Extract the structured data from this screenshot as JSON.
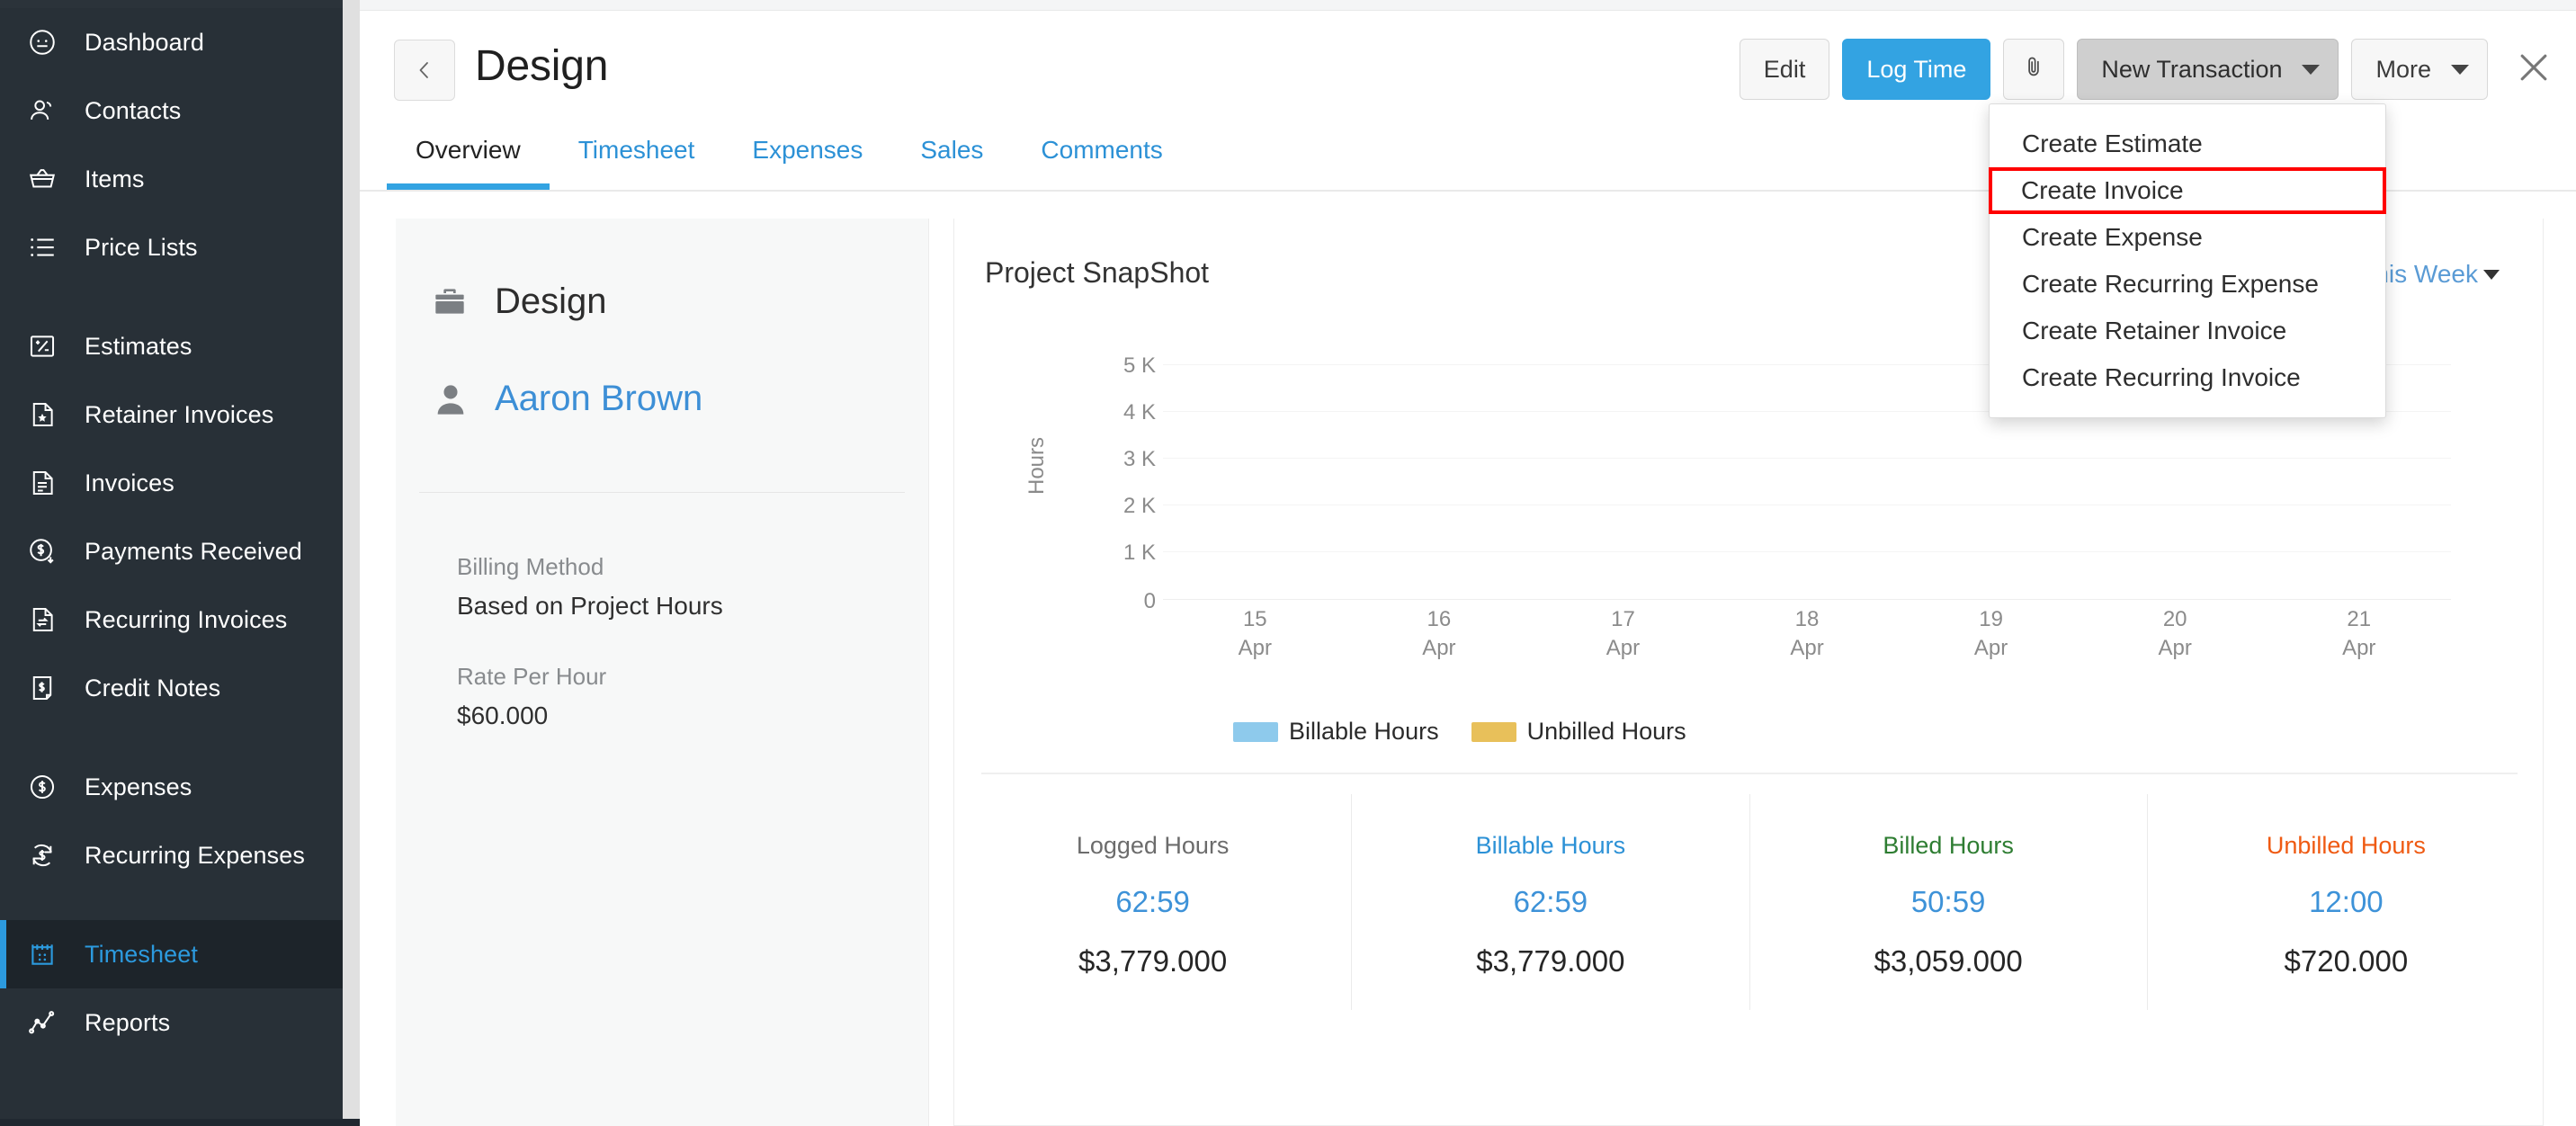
{
  "sidebar": {
    "items": [
      {
        "label": "Dashboard",
        "icon": "speedometer-icon",
        "active": false
      },
      {
        "label": "Contacts",
        "icon": "contacts-icon",
        "active": false
      },
      {
        "label": "Items",
        "icon": "basket-icon",
        "active": false
      },
      {
        "label": "Price Lists",
        "icon": "list-icon",
        "active": false
      },
      {
        "label": "Estimates",
        "icon": "estimate-icon",
        "active": false
      },
      {
        "label": "Retainer Invoices",
        "icon": "retainer-invoice-icon",
        "active": false
      },
      {
        "label": "Invoices",
        "icon": "invoice-icon",
        "active": false
      },
      {
        "label": "Payments Received",
        "icon": "payment-received-icon",
        "active": false
      },
      {
        "label": "Recurring Invoices",
        "icon": "recurring-invoice-icon",
        "active": false
      },
      {
        "label": "Credit Notes",
        "icon": "credit-note-icon",
        "active": false
      },
      {
        "label": "Expenses",
        "icon": "expense-icon",
        "active": false
      },
      {
        "label": "Recurring Expenses",
        "icon": "recurring-expense-icon",
        "active": false
      },
      {
        "label": "Timesheet",
        "icon": "timesheet-icon",
        "active": true
      },
      {
        "label": "Reports",
        "icon": "reports-icon",
        "active": false
      }
    ]
  },
  "header": {
    "back_icon": "chevron-left-icon",
    "title": "Design",
    "edit_label": "Edit",
    "log_time_label": "Log Time",
    "attachment_icon": "paperclip-icon",
    "new_transaction_label": "New Transaction",
    "more_label": "More",
    "close_icon": "close-icon"
  },
  "tabs": [
    {
      "label": "Overview",
      "selected": true
    },
    {
      "label": "Timesheet",
      "selected": false
    },
    {
      "label": "Expenses",
      "selected": false
    },
    {
      "label": "Sales",
      "selected": false
    },
    {
      "label": "Comments",
      "selected": false
    }
  ],
  "transaction_menu": {
    "items": [
      {
        "label": "Create Estimate",
        "highlighted": false
      },
      {
        "label": "Create Invoice",
        "highlighted": true
      },
      {
        "label": "Create Expense",
        "highlighted": false
      },
      {
        "label": "Create Recurring Expense",
        "highlighted": false
      },
      {
        "label": "Create Retainer Invoice",
        "highlighted": false
      },
      {
        "label": "Create Recurring Invoice",
        "highlighted": false
      }
    ],
    "highlight_color": "#ff0000"
  },
  "project_card": {
    "project_icon": "briefcase-icon",
    "project_name": "Design",
    "client_icon": "user-icon",
    "client_name": "Aaron Brown",
    "billing_method_label": "Billing Method",
    "billing_method_value": "Based on Project Hours",
    "rate_label": "Rate Per Hour",
    "rate_value": "$60.000"
  },
  "snapshot": {
    "title": "Project SnapShot",
    "period_label": "This Week",
    "period_caret": "chevron-down-icon",
    "stats": [
      {
        "label": "Logged Hours",
        "label_color": "#6c6c6c",
        "hours": "62:59",
        "amount": "$3,779.000"
      },
      {
        "label": "Billable Hours",
        "label_color": "#2c91d6",
        "hours": "62:59",
        "amount": "$3,779.000"
      },
      {
        "label": "Billed Hours",
        "label_color": "#2e7d32",
        "hours": "50:59",
        "amount": "$3,059.000"
      },
      {
        "label": "Unbilled Hours",
        "label_color": "#ef5a12",
        "hours": "12:00",
        "amount": "$720.000"
      }
    ]
  },
  "chart_data": {
    "type": "bar",
    "title": "Project SnapShot",
    "xlabel": "",
    "ylabel": "Hours",
    "categories": [
      "15 Apr",
      "16 Apr",
      "17 Apr",
      "18 Apr",
      "19 Apr",
      "20 Apr",
      "21 Apr"
    ],
    "x_tick_days": [
      "15",
      "16",
      "17",
      "18",
      "19",
      "20",
      "21"
    ],
    "x_tick_months": [
      "Apr",
      "Apr",
      "Apr",
      "Apr",
      "Apr",
      "Apr",
      "Apr"
    ],
    "y_ticks": [
      "0",
      "1 K",
      "2 K",
      "3 K",
      "4 K",
      "5 K"
    ],
    "ylim": [
      0,
      5000
    ],
    "grid": true,
    "legend_position": "bottom-left",
    "series": [
      {
        "name": "Billable Hours",
        "color": "#8ecaec",
        "values": [
          0,
          0,
          0,
          0,
          0,
          0,
          0
        ]
      },
      {
        "name": "Unbilled Hours",
        "color": "#e8c05a",
        "values": [
          0,
          0,
          0,
          0,
          0,
          0,
          0
        ]
      }
    ]
  }
}
